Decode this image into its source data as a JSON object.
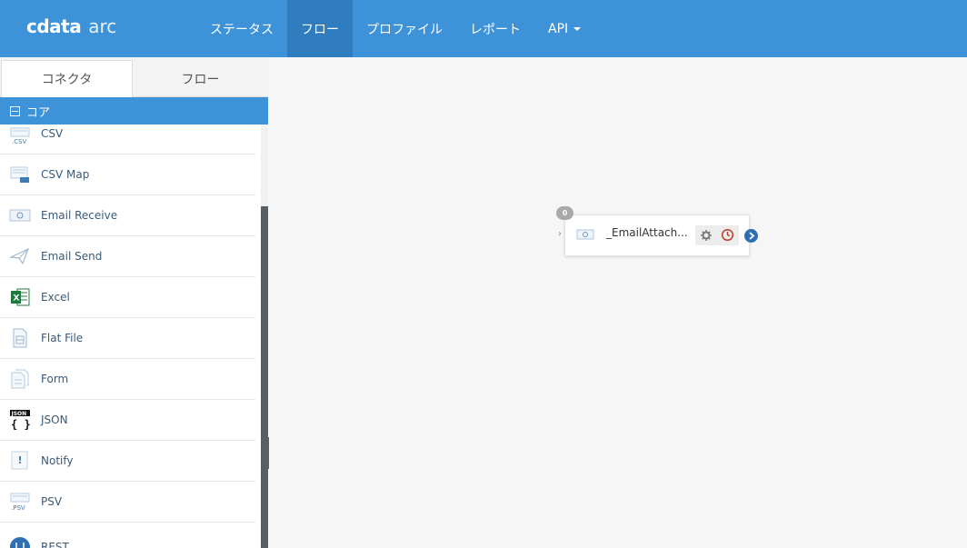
{
  "app": {
    "logo_brand": "cdata",
    "logo_product": "arc"
  },
  "nav": {
    "items": [
      {
        "label": "ステータス",
        "active": false
      },
      {
        "label": "フロー",
        "active": true
      },
      {
        "label": "プロファイル",
        "active": false
      },
      {
        "label": "レポート",
        "active": false
      },
      {
        "label": "API",
        "active": false,
        "dropdown": true
      }
    ]
  },
  "sidebar": {
    "tabs": [
      {
        "label": "コネクタ",
        "active": true
      },
      {
        "label": "フロー",
        "active": false
      }
    ],
    "section": {
      "label": "コア",
      "icon": "collapse-minus-icon"
    },
    "connectors": [
      {
        "label": "CSV",
        "icon": "csv-icon"
      },
      {
        "label": "CSV Map",
        "icon": "csv-map-icon"
      },
      {
        "label": "Email Receive",
        "icon": "email-receive-icon"
      },
      {
        "label": "Email Send",
        "icon": "paper-plane-icon"
      },
      {
        "label": "Excel",
        "icon": "excel-icon"
      },
      {
        "label": "Flat File",
        "icon": "flat-file-icon"
      },
      {
        "label": "Form",
        "icon": "form-icon"
      },
      {
        "label": "JSON",
        "icon": "json-icon"
      },
      {
        "label": "Notify",
        "icon": "notify-icon"
      },
      {
        "label": "PSV",
        "icon": "psv-icon"
      },
      {
        "label": "REST",
        "icon": "rest-icon"
      }
    ],
    "icon_texts": {
      "csv": ".CSV",
      "json": "JSON",
      "json_braces": "{ }",
      "notify": "!",
      "psv": ".PSV",
      "excel": "X"
    }
  },
  "canvas": {
    "node": {
      "label": "_EmailAttach...",
      "badge": "0",
      "icon": "email-receive-icon",
      "accent": "#2e6fb3"
    }
  },
  "colors": {
    "header": "#3d92d8",
    "header_active": "#2f7cbf",
    "section_header": "#3d92d8",
    "canvas_bg": "#f6f6f6"
  }
}
